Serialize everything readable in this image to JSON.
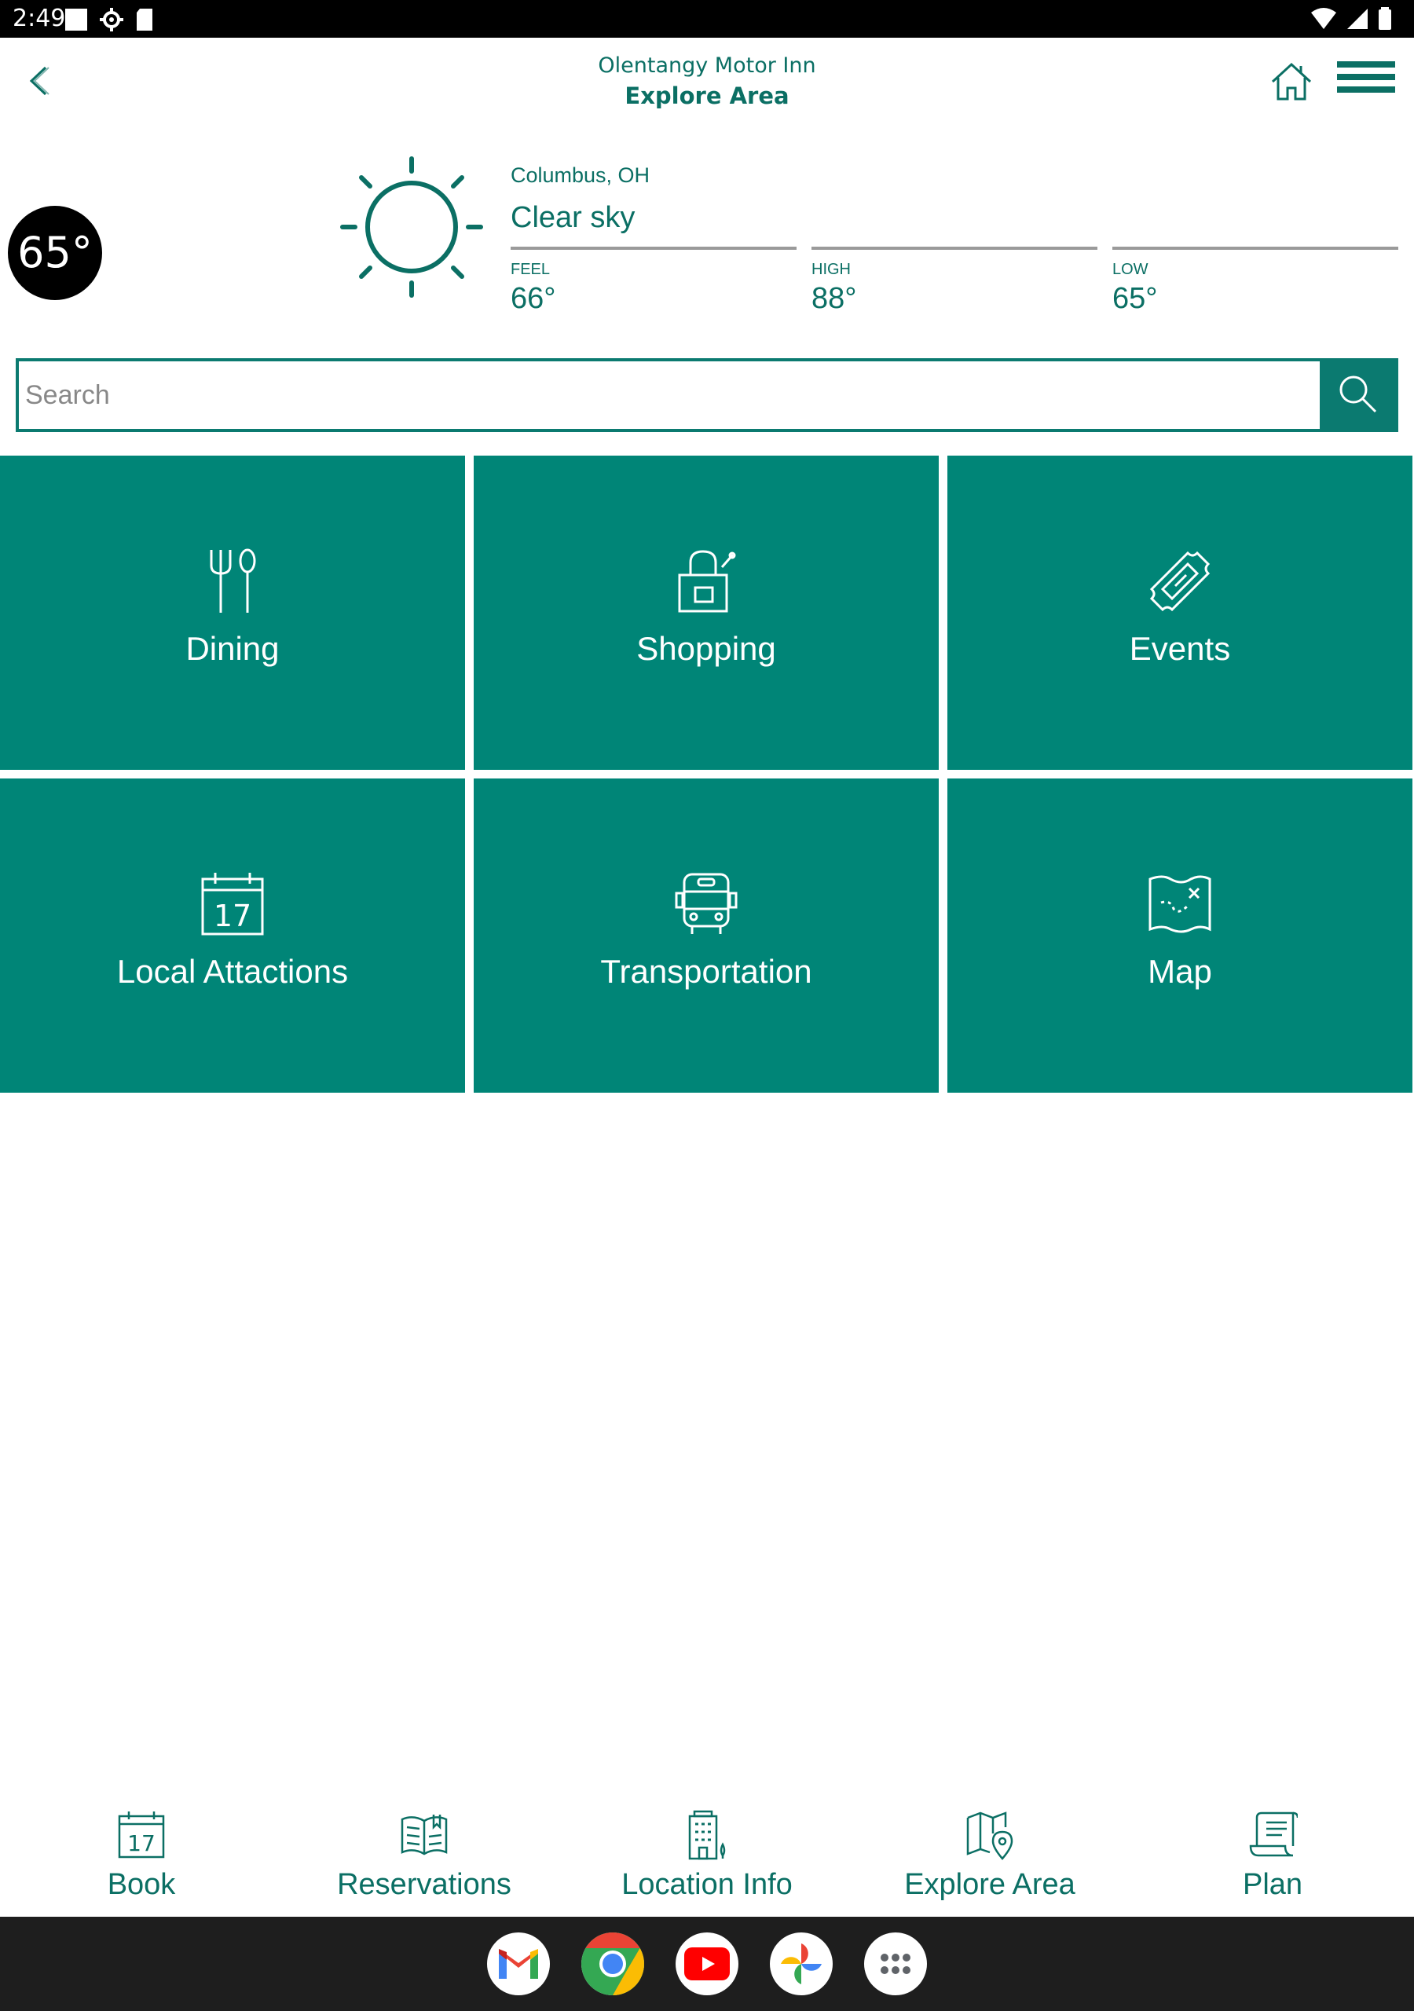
{
  "status_bar": {
    "time": "2:49"
  },
  "header": {
    "subtitle": "Olentangy Motor Inn",
    "title": "Explore Area"
  },
  "weather": {
    "current_temp": "65°",
    "city": "Columbus, OH",
    "condition": "Clear sky",
    "feel_label": "FEEL",
    "feel_value": "66°",
    "high_label": "HIGH",
    "high_value": "88°",
    "low_label": "LOW",
    "low_value": "65°",
    "icon": "sun-icon"
  },
  "search": {
    "placeholder": "Search",
    "value": ""
  },
  "tiles": [
    {
      "label": "Dining",
      "icon": "fork-spoon-icon"
    },
    {
      "label": "Shopping",
      "icon": "shopping-bag-icon"
    },
    {
      "label": "Events",
      "icon": "ticket-icon"
    },
    {
      "label": "Local Attactions",
      "icon": "calendar-icon",
      "icon_text": "17"
    },
    {
      "label": "Transportation",
      "icon": "bus-icon"
    },
    {
      "label": "Map",
      "icon": "map-icon"
    }
  ],
  "bottom_nav": [
    {
      "label": "Book",
      "icon": "calendar-icon",
      "icon_text": "17"
    },
    {
      "label": "Reservations",
      "icon": "open-book-icon"
    },
    {
      "label": "Location Info",
      "icon": "building-icon"
    },
    {
      "label": "Explore Area",
      "icon": "map-pin-icon"
    },
    {
      "label": "Plan",
      "icon": "scroll-icon"
    }
  ],
  "dock_apps": [
    "gmail-icon",
    "chrome-icon",
    "youtube-icon",
    "photos-icon",
    "app-drawer-icon"
  ],
  "colors": {
    "primary": "#008577",
    "primary_text": "#0b6f64",
    "status_bar": "#000000",
    "dock": "#1e1e1e"
  }
}
